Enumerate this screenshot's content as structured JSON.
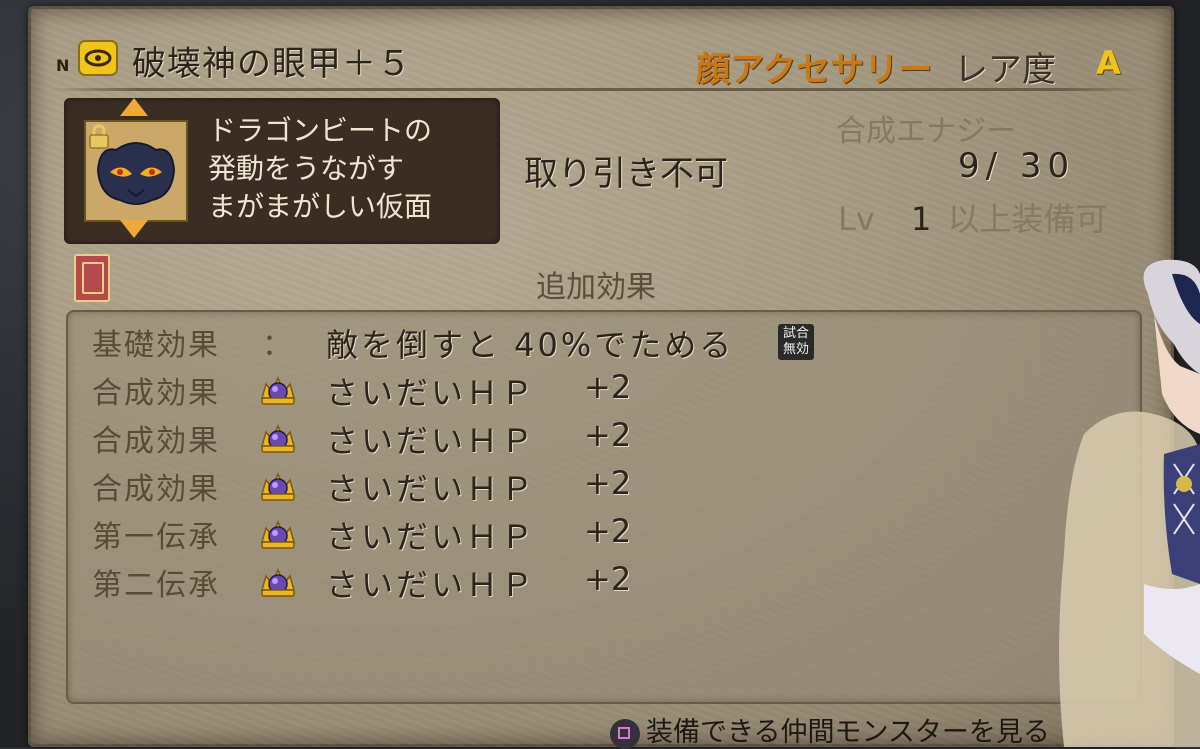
{
  "item": {
    "rank_mark": "N",
    "category_icon": "accessory-eye-icon",
    "name": "破壊神の眼甲＋５",
    "category": "顔アクセサリー",
    "rarity_label": "レア度",
    "rarity_value": "A"
  },
  "description": {
    "lines": [
      "ドラゴンビートの",
      "発動をうながす",
      "まがまがしい仮面"
    ],
    "icon": "demon-mask-icon",
    "lock_icon": "lock-icon"
  },
  "trade_status": "取り引き不可",
  "energy": {
    "label": "合成エナジー",
    "value": "9/  30"
  },
  "level": {
    "prefix": "Lv",
    "value": "1",
    "suffix": "以上装備可"
  },
  "effects": {
    "title": "追加効果",
    "book_icon": "book-icon",
    "rows": [
      {
        "label": "基礎効果",
        "colon": "：",
        "value": "敵を倒すと 40%でためる",
        "badge": "試合\n無効"
      },
      {
        "label": "合成効果",
        "value": "さいだいＨＰ",
        "plus": "+2",
        "icon": "purple-orb-icon"
      },
      {
        "label": "合成効果",
        "value": "さいだいＨＰ",
        "plus": "+2",
        "icon": "purple-orb-icon"
      },
      {
        "label": "合成効果",
        "value": "さいだいＨＰ",
        "plus": "+2",
        "icon": "purple-orb-icon"
      },
      {
        "label": "第一伝承",
        "value": "さいだいＨＰ",
        "plus": "+2",
        "icon": "purple-orb-icon"
      },
      {
        "label": "第二伝承",
        "value": "さいだいＨＰ",
        "plus": "+2",
        "icon": "purple-orb-icon"
      }
    ]
  },
  "footer": {
    "button_icon": "square-button-icon",
    "label": "装備できる仲間モンスターを見る"
  },
  "colors": {
    "parchment": "#a59a82",
    "category_orange": "#c97818",
    "rarity_gold": "#f0c418"
  }
}
